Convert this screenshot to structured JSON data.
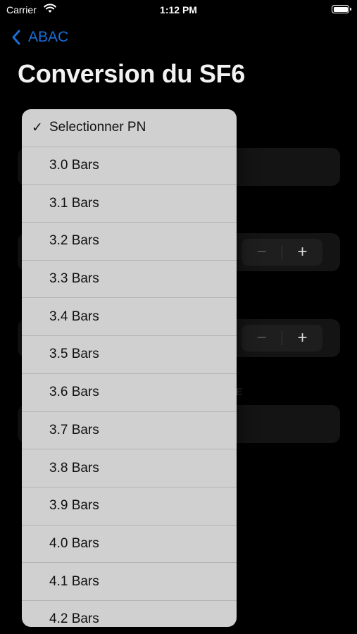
{
  "status_bar": {
    "carrier": "Carrier",
    "time": "1:12 PM",
    "icons": [
      "wifi-icon",
      "battery-icon"
    ]
  },
  "nav": {
    "back_label": "ABAC",
    "title": "Conversion du SF6"
  },
  "background_form": {
    "stepper_minus": "−",
    "stepper_plus": "+",
    "faint_text": "E"
  },
  "menu": {
    "selected_index": 0,
    "items": [
      {
        "label": "Selectionner PN",
        "checked": "✓"
      },
      {
        "label": "3.0 Bars"
      },
      {
        "label": "3.1 Bars"
      },
      {
        "label": "3.2 Bars"
      },
      {
        "label": "3.3 Bars"
      },
      {
        "label": "3.4 Bars"
      },
      {
        "label": "3.5 Bars"
      },
      {
        "label": "3.6 Bars"
      },
      {
        "label": "3.7 Bars"
      },
      {
        "label": "3.8 Bars"
      },
      {
        "label": "3.9 Bars"
      },
      {
        "label": "4.0 Bars"
      },
      {
        "label": "4.1 Bars"
      },
      {
        "label": "4.2 Bars"
      }
    ]
  },
  "colors": {
    "accent": "#1a6ed8",
    "background": "#000000",
    "menu_background": "#d0d0d0"
  }
}
